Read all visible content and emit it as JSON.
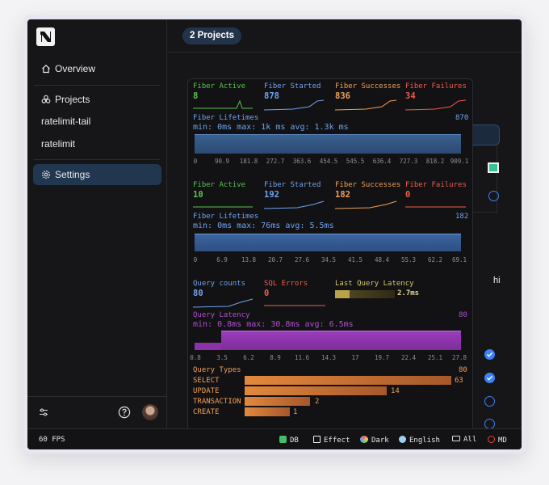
{
  "colors": {
    "sidebar_active": "#21364f",
    "green": "#5ac24f",
    "blue": "#6fa3ee",
    "orange": "#f0a058",
    "red": "#ee5c4c",
    "purple": "#b04fd3",
    "yellow": "#d7c46a",
    "query_bar": "#e3893d"
  },
  "sidebar": {
    "logo_icon": "app-logo",
    "items": [
      {
        "label": "Overview",
        "icon": "home-icon"
      },
      {
        "label": "Projects",
        "icon": "projects-icon"
      },
      {
        "label": "ratelimit-tail"
      },
      {
        "label": "ratelimit"
      },
      {
        "label": "Settings",
        "icon": "gear-icon",
        "active": true
      }
    ],
    "bottom": {
      "sliders_icon": "sliders-icon",
      "help_icon": "help-icon",
      "avatar": "user-avatar"
    }
  },
  "header": {
    "projects_label": "2 Projects"
  },
  "right_panel": {
    "hi_label": "hi"
  },
  "monitor": {
    "section1": {
      "fiber_active": {
        "label": "Fiber Active",
        "value": "8"
      },
      "fiber_started": {
        "label": "Fiber Started",
        "value": "878"
      },
      "fiber_successes": {
        "label": "Fiber Successes",
        "value": "836"
      },
      "fiber_failures": {
        "label": "Fiber Failures",
        "value": "34"
      },
      "lifetimes": {
        "label": "Fiber Lifetimes",
        "count": "870",
        "stats": "min: 0ms max: 1k ms avg: 1.3k ms"
      },
      "ticks": [
        "0",
        "90.9",
        "181.8",
        "272.7",
        "363.6",
        "454.5",
        "545.5",
        "636.4",
        "727.3",
        "818.2",
        "909.1"
      ]
    },
    "section2": {
      "fiber_active": {
        "label": "Fiber Active",
        "value": "10"
      },
      "fiber_started": {
        "label": "Fiber Started",
        "value": "192"
      },
      "fiber_successes": {
        "label": "Fiber Successes",
        "value": "182"
      },
      "fiber_failures": {
        "label": "Fiber Failures",
        "value": "0"
      },
      "lifetimes": {
        "label": "Fiber Lifetimes",
        "count": "182",
        "stats": "min: 0ms max: 76ms avg: 5.5ms"
      },
      "ticks": [
        "0",
        "6.9",
        "13.8",
        "20.7",
        "27.6",
        "34.5",
        "41.5",
        "48.4",
        "55.3",
        "62.2",
        "69.1"
      ]
    },
    "queries": {
      "query_counts": {
        "label": "Query counts",
        "value": "80"
      },
      "sql_errors": {
        "label": "SQL Errors",
        "value": "0"
      },
      "last_latency": {
        "label": "Last Query Latency",
        "value": "2.7ms"
      },
      "latency": {
        "label": "Query Latency",
        "count": "80",
        "stats": "min: 0.8ms max: 30.8ms avg: 6.5ms"
      },
      "ticks": [
        "0.8",
        "3.5",
        "6.2",
        "8.9",
        "11.6",
        "14.3",
        "17",
        "19.7",
        "22.4",
        "25.1",
        "27.8"
      ],
      "types_label": "Query Types",
      "types_count": "80",
      "types": [
        {
          "name": "SELECT",
          "count": 63
        },
        {
          "name": "UPDATE",
          "count": 14
        },
        {
          "name": "TRANSACTION",
          "count": 2
        },
        {
          "name": "CREATE",
          "count": 1
        }
      ]
    }
  },
  "statusbar": {
    "fps": "60 FPS",
    "db": "DB",
    "effect": "Effect",
    "theme": "Dark",
    "language": "English",
    "all": "All",
    "md": "MD"
  }
}
